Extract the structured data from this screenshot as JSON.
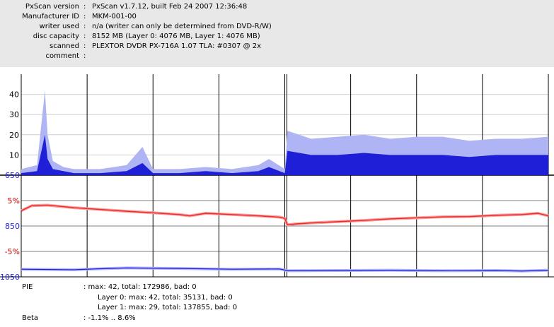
{
  "header": {
    "rows": [
      {
        "label": "PxScan version",
        "value": "PxScan v1.7.12, built Feb 24 2007 12:36:48"
      },
      {
        "label": "Manufacturer ID",
        "value": "MKM-001-00"
      },
      {
        "label": "writer used",
        "value": "n/a (writer can only be determined from DVD-R/W)"
      },
      {
        "label": "disc capacity",
        "value": "8152 MB (Layer 0: 4076 MB,  Layer 1: 4076 MB)"
      },
      {
        "label": "scanned",
        "value": "PLEXTOR DVDR  PX-716A 1.07 TLA: #0307 @ 2x"
      },
      {
        "label": "comment",
        "value": ""
      }
    ]
  },
  "chart_data": [
    {
      "type": "area",
      "name": "PIE",
      "ylim": [
        0,
        50
      ],
      "y_ticks": [
        "10",
        "20",
        "30",
        "40"
      ],
      "x_divisions": 8,
      "layer_break_fraction": 0.5,
      "colors": {
        "max": "#aeb4f4",
        "avg": "#1f1fd8",
        "axis_text": "#000000"
      },
      "series": [
        {
          "x": [
            0,
            0.03,
            0.045,
            0.05,
            0.06,
            0.08,
            0.1,
            0.15,
            0.2,
            0.23,
            0.25,
            0.3,
            0.35,
            0.4,
            0.45,
            0.47,
            0.5,
            0.505,
            0.55,
            0.6,
            0.65,
            0.7,
            0.75,
            0.8,
            0.85,
            0.9,
            0.95,
            1.0
          ],
          "values": [
            3,
            5,
            42,
            20,
            7,
            4,
            3,
            3,
            5,
            14,
            3,
            3,
            4,
            3,
            5,
            8,
            3,
            22,
            18,
            19,
            20,
            18,
            19,
            19,
            17,
            18,
            18,
            19
          ]
        },
        {
          "x": [
            0,
            0.03,
            0.045,
            0.05,
            0.06,
            0.08,
            0.1,
            0.15,
            0.2,
            0.23,
            0.25,
            0.3,
            0.35,
            0.4,
            0.45,
            0.47,
            0.5,
            0.505,
            0.55,
            0.6,
            0.65,
            0.7,
            0.75,
            0.8,
            0.85,
            0.9,
            0.95,
            1.0
          ],
          "values": [
            1,
            2,
            20,
            8,
            3,
            2,
            1,
            1,
            2,
            6,
            1,
            1,
            2,
            1,
            2,
            4,
            1,
            12,
            10,
            10,
            11,
            10,
            10,
            10,
            9,
            10,
            10,
            10
          ]
        }
      ]
    },
    {
      "type": "line",
      "name": "Jitter",
      "y_ticks": [
        "650",
        "5%",
        "850",
        "-5%",
        "1050"
      ],
      "ylim": [
        1050,
        650
      ],
      "colors": {
        "line": "#ee2a2a",
        "line_light": "#f4a0a0",
        "tick_pct": "#d00000",
        "tick_num": "#1f1fd8"
      },
      "series": [
        {
          "x": [
            0,
            0.02,
            0.05,
            0.1,
            0.15,
            0.2,
            0.25,
            0.3,
            0.32,
            0.35,
            0.4,
            0.45,
            0.49,
            0.5,
            0.505,
            0.52,
            0.55,
            0.6,
            0.65,
            0.7,
            0.75,
            0.8,
            0.85,
            0.88,
            0.9,
            0.95,
            0.98,
            1.0
          ],
          "values": [
            790,
            770,
            768,
            778,
            785,
            792,
            798,
            805,
            810,
            800,
            805,
            810,
            815,
            820,
            845,
            842,
            838,
            833,
            828,
            822,
            818,
            814,
            813,
            810,
            808,
            805,
            800,
            810
          ]
        }
      ]
    },
    {
      "type": "line",
      "name": "Beta",
      "colors": {
        "line": "#1f1fd8",
        "line_light": "#aeb4f4"
      },
      "series": [
        {
          "x": [
            0,
            0.1,
            0.15,
            0.2,
            0.3,
            0.4,
            0.49,
            0.5,
            0.505,
            0.6,
            0.7,
            0.8,
            0.9,
            0.95,
            1.0
          ],
          "values": [
            1020,
            1022,
            1018,
            1015,
            1017,
            1020,
            1019,
            1023,
            1026,
            1025,
            1024,
            1026,
            1025,
            1027,
            1024
          ]
        }
      ]
    }
  ],
  "footer": {
    "pie_label": "PIE",
    "pie_total": ": max: 42, total: 172986, bad: 0",
    "pie_layer0": "Layer 0: max: 42, total: 35131, bad: 0",
    "pie_layer1": "Layer 1: max: 29, total: 137855, bad: 0",
    "beta_label": "Beta",
    "beta_value": ": -1.1% .. 8.6%"
  }
}
